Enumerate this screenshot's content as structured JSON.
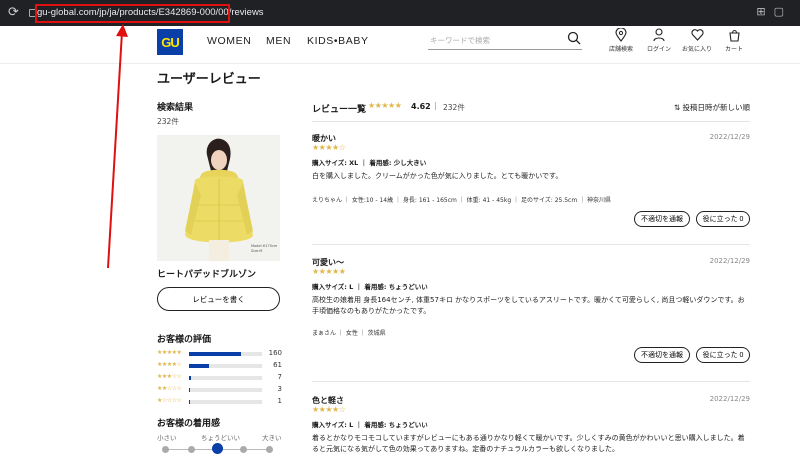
{
  "browser": {
    "url": "gu-global.com/jp/ja/products/E342869-000/00/reviews"
  },
  "header": {
    "logo": "GU",
    "nav": [
      "WOMEN",
      "MEN",
      "KIDS•BABY"
    ],
    "search_placeholder": "キーワードで検索",
    "icons": [
      {
        "icon": "pin-icon",
        "label": "店舗検索"
      },
      {
        "icon": "user-icon",
        "label": "ログイン"
      },
      {
        "icon": "heart-icon",
        "label": "お気に入り"
      },
      {
        "icon": "cart-icon",
        "label": "カート"
      }
    ]
  },
  "page_title": "ユーザーレビュー",
  "sidebar": {
    "result_heading": "検索結果",
    "result_count": "232件",
    "photo_caption": "Model:H170cm\nSize:M",
    "product_name": "ヒートパデッドブルゾン",
    "write_review": "レビューを書く",
    "rating_heading": "お客様の評価",
    "ratings": [
      {
        "stars": "★★★★★",
        "count": "160",
        "fraction": 0.71
      },
      {
        "stars": "★★★★☆",
        "count": "61",
        "fraction": 0.27
      },
      {
        "stars": "★★★☆☆",
        "count": "7",
        "fraction": 0.03
      },
      {
        "stars": "★★☆☆☆",
        "count": "3",
        "fraction": 0.013
      },
      {
        "stars": "★☆☆☆☆",
        "count": "1",
        "fraction": 0.005
      }
    ],
    "fit_heading": "お客様の着用感",
    "fit_labels": [
      "小さい",
      "ちょうどいい",
      "大きい"
    ],
    "fit_value": 0.5
  },
  "list": {
    "heading": "レビュー一覧",
    "avg_stars": "★★★★★",
    "avg": "4.62",
    "separator": "|",
    "count": "232件",
    "sort_label": "投稿日時が新しい順",
    "sort_icon": "sort-icon",
    "reviews": [
      {
        "title": "暖かい",
        "date": "2022/12/29",
        "stars": "★★★★☆",
        "size": "購入サイズ: XL ｜ 着用感: 少し大きい",
        "body": "白を購入しました。クリームがかった色が気に入りました。とても暖かいです。",
        "info": "えりちゃん ｜ 女性:10 - 14歳 ｜ 身長: 161 - 165cm ｜ 体重: 41 - 45kg ｜ 足のサイズ: 25.5cm ｜ 神奈川県",
        "report": "不適切を通報",
        "helpful": "役に立った 0"
      },
      {
        "title": "可愛い〜",
        "date": "2022/12/29",
        "stars": "★★★★★",
        "size": "購入サイズ: L ｜ 着用感: ちょうどいい",
        "body": "高校生の娘着用 身長164センチ, 体重57キロ かなりスポーツをしているアスリートです。暖かくて可愛らしく, 尚且つ軽いダウンです。お手頃価格なのもありがたかったです。",
        "info": "まぁさん ｜ 女性 ｜ 茨城県",
        "report": "不適切を通報",
        "helpful": "役に立った 0"
      },
      {
        "title": "色と軽さ",
        "date": "2022/12/29",
        "stars": "★★★★☆",
        "size": "購入サイズ: L ｜ 着用感: ちょうどいい",
        "body": "着るとかなりモコモコしていますがレビューにもある通りかなり軽くて暖かいです。少しくすみの黄色がかわいいと思い購入しました。着ると元気になる気がして色の効果ってありますね。定番のナチュラルカラーも欲しくなりました。"
      }
    ]
  }
}
